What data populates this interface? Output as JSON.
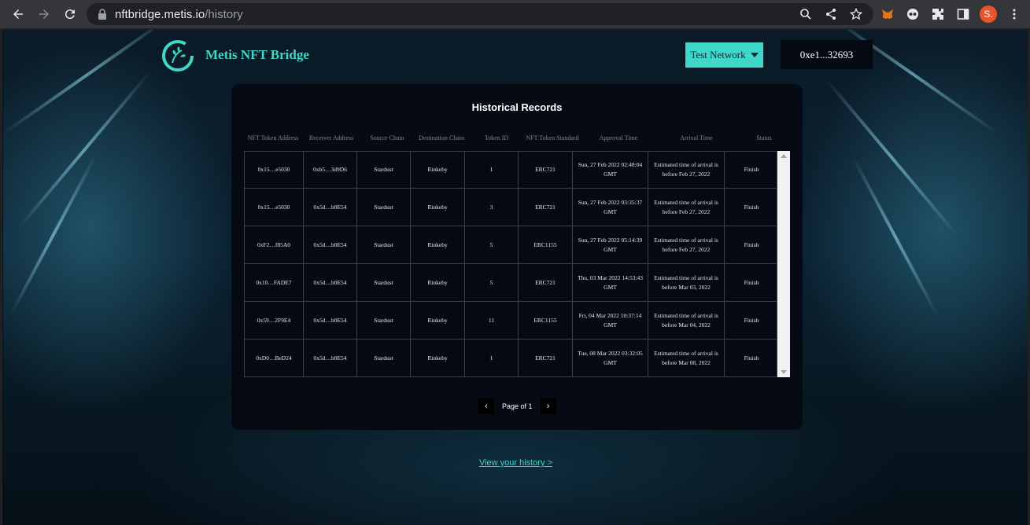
{
  "browser": {
    "url_host": "nftbridge.metis.io",
    "url_path": "/history",
    "avatar_letter": "S."
  },
  "header": {
    "brand": "Metis NFT Bridge",
    "network_label": "Test Network",
    "wallet_label": "0xe1...32693"
  },
  "card": {
    "title": "Historical Records",
    "columns": [
      "NFT Token Address",
      "Receiver Address",
      "Source Chain",
      "Destination Chain",
      "Token ID",
      "NFT Token Standard",
      "Approval Time",
      "Arrival Time",
      "Status"
    ],
    "rows": [
      [
        "0x15…e5030",
        "0xb5…3d9D6",
        "Stardust",
        "Rinkeby",
        "1",
        "ERC721",
        "Sun, 27 Feb 2022 02:48:04 GMT",
        "Estimated time of arrival is before Feb 27, 2022",
        "Finish"
      ],
      [
        "0x15…e5030",
        "0x5d…b0E54",
        "Stardust",
        "Rinkeby",
        "3",
        "ERC721",
        "Sun, 27 Feb 2022 03:35:37 GMT",
        "Estimated time of arrival is before Feb 27, 2022",
        "Finish"
      ],
      [
        "0xF2…f85A0",
        "0x5d…b0E54",
        "Stardust",
        "Rinkeby",
        "5",
        "ERC1155",
        "Sun, 27 Feb 2022 05:14:39 GMT",
        "Estimated time of arrival is before Feb 27, 2022",
        "Finish"
      ],
      [
        "0x10…FADE7",
        "0x5d…b0E54",
        "Stardust",
        "Rinkeby",
        "5",
        "ERC721",
        "Thu, 03 Mar 2022 14:53:43 GMT",
        "Estimated time of arrival is before Mar 03, 2022",
        "Finish"
      ],
      [
        "0x59…2F9E4",
        "0x5d…b0E54",
        "Stardust",
        "Rinkeby",
        "11",
        "ERC1155",
        "Fri, 04 Mar 2022 10:37:14 GMT",
        "Estimated time of arrival is before Mar 04, 2022",
        "Finish"
      ],
      [
        "0xD0…BeD24",
        "0x5d…b0E54",
        "Stardust",
        "Rinkeby",
        "1",
        "ERC721",
        "Tue, 08 Mar 2022 03:32:05 GMT",
        "Estimated time of arrival is before Mar 08, 2022",
        "Finish"
      ]
    ],
    "pager_text": "Page of 1"
  },
  "history_link": "View your history >",
  "colors": {
    "accent": "#3fd7c8",
    "card_bg": "#060a12"
  }
}
